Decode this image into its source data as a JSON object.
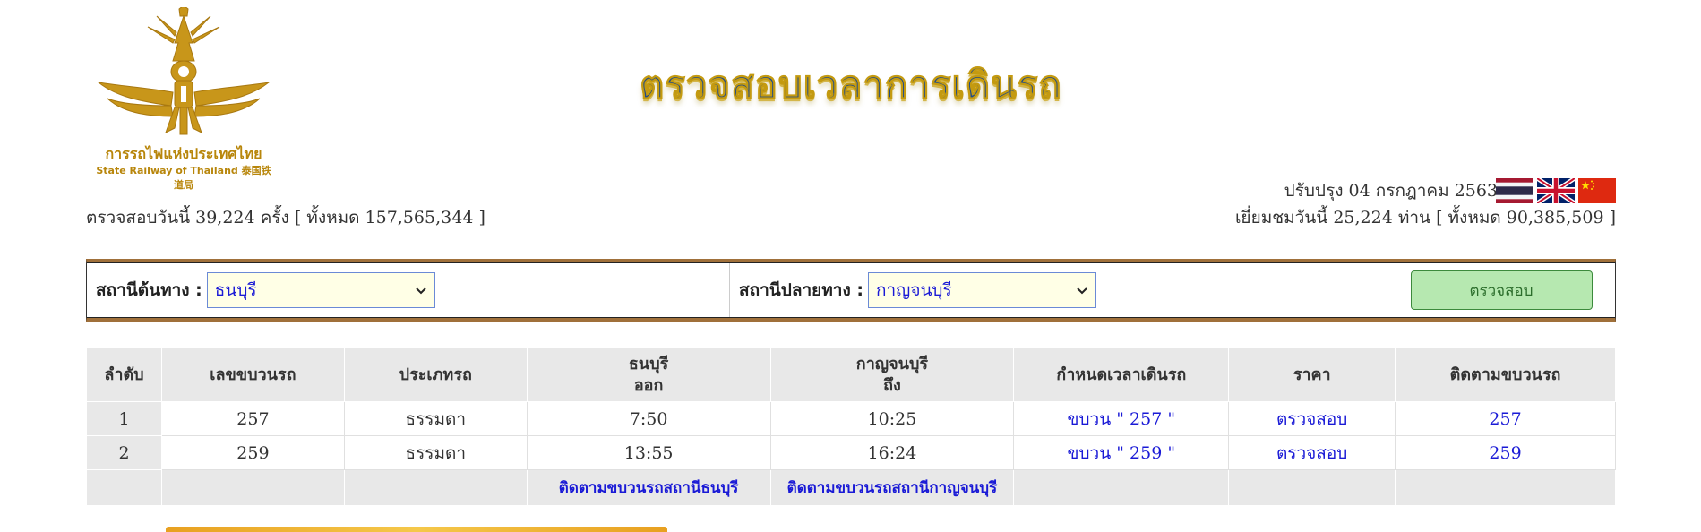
{
  "logo": {
    "text_th": "การรถไฟแห่งประเทศไทย",
    "text_en": "State Railway of Thailand 泰国铁道局"
  },
  "page_title": "ตรวจสอบเวลาการเดินรถ",
  "updated": "ปรับปรุง 04 กรกฎาคม 2563",
  "flags": [
    "thai-flag-icon",
    "uk-flag-icon",
    "china-flag-icon"
  ],
  "stats": {
    "left": "ตรวจสอบวันนี้ 39,224 ครั้ง [ ทั้งหมด  157,565,344  ]",
    "right": "เยี่ยมชมวันนี้ 25,224 ท่าน [ ทั้งหมด  90,385,509 ]"
  },
  "search": {
    "origin_label": "สถานีต้นทาง :",
    "origin_value": "ธนบุรี",
    "dest_label": "สถานีปลายทาง :",
    "dest_value": "กาญจนบุรี",
    "check_label": "ตรวจสอบ"
  },
  "table": {
    "headers": {
      "no": "ลำดับ",
      "train_no": "เลขขบวนรถ",
      "type": "ประเภทรถ",
      "origin_station": "ธนบุรี",
      "origin_sub": "ออก",
      "dest_station": "กาญจนบุรี",
      "dest_sub": "ถึง",
      "schedule": "กำหนดเวลาเดินรถ",
      "price": "ราคา",
      "track": "ติดตามขบวนรถ"
    },
    "rows": [
      {
        "no": "1",
        "train_no": "257",
        "type": "ธรรมดา",
        "depart": "7:50",
        "arrive": "10:25",
        "schedule": "ขบวน \" 257 \"",
        "price": "ตรวจสอบ",
        "track": "257"
      },
      {
        "no": "2",
        "train_no": "259",
        "type": "ธรรมดา",
        "depart": "13:55",
        "arrive": "16:24",
        "schedule": "ขบวน \" 259 \"",
        "price": "ตรวจสอบ",
        "track": "259"
      }
    ],
    "footer": {
      "track_origin": "ติดตามขบวนรถสถานีธนบุรี",
      "track_dest": "ติดตามขบวนรถสถานีกาญจนบุรี"
    }
  },
  "colors": {
    "gold": "#b8860b",
    "link": "#1a1ad6",
    "button_bg": "#b6e8b0",
    "border_brown": "#a0703a"
  }
}
